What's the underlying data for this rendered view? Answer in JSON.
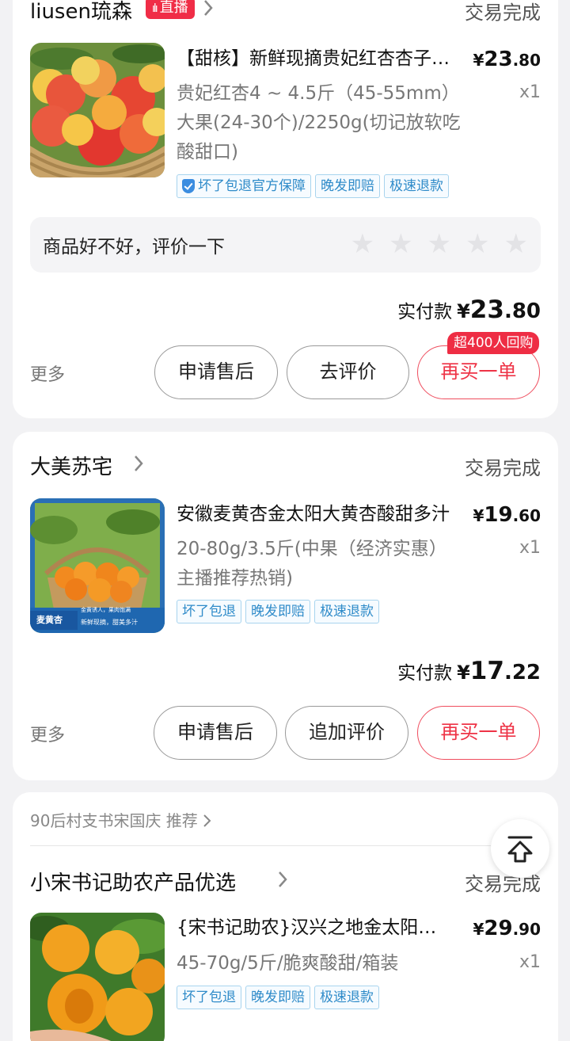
{
  "colors": {
    "accent": "#ee3346",
    "tag_blue": "#2f8bc9",
    "live_red": "#f02d47"
  },
  "orders": [
    {
      "shop_name": "liusen琉森",
      "live_badge": "直播",
      "status": "交易完成",
      "product": {
        "title": "【甜核】新鲜现摘贵妃红杏杏子包邮",
        "price_yen": "¥",
        "price_int": "23",
        "price_dec": ".80",
        "spec": "贵妃红杏4 ~ 4.5斤（45-55mm）大果(24-30个)/2250g(切记放软吃酸甜口)",
        "qty": "x1",
        "tags": [
          "坏了包退官方保障",
          "晚发即赔",
          "极速退款"
        ]
      },
      "review_prompt": "商品好不好，评价一下",
      "paid_label": "实付款",
      "paid_yen": "¥",
      "paid_int": "23",
      "paid_dec": ".80",
      "more": "更多",
      "buttons": [
        "申请售后",
        "去评价",
        "再买一单"
      ],
      "repurchase_badge": "超400人回购"
    },
    {
      "shop_name": "大美苏宅",
      "status": "交易完成",
      "product": {
        "title": "安徽麦黄杏金太阳大黄杏酸甜多汁",
        "price_yen": "¥",
        "price_int": "19",
        "price_dec": ".60",
        "spec": "20-80g/3.5斤(中果（经济实惠）主播推荐热销)",
        "qty": "x1",
        "tags": [
          "坏了包退",
          "晚发即赔",
          "极速退款"
        ],
        "image_captions": [
          "麦黄杏",
          "金黄诱人，果肉饱满",
          "新鲜现摘，甜美多汁"
        ]
      },
      "paid_label": "实付款",
      "paid_yen": "¥",
      "paid_int": "17",
      "paid_dec": ".22",
      "more": "更多",
      "buttons": [
        "申请售后",
        "追加评价",
        "再买一单"
      ]
    },
    {
      "recommender": "90后村支书宋国庆 推荐",
      "shop_name": "小宋书记助农产品优选",
      "status": "交易完成",
      "product": {
        "title": "{宋书记助农}汉兴之地金太阳杏子",
        "price_yen": "¥",
        "price_int": "29",
        "price_dec": ".90",
        "spec": "45-70g/5斤/脆爽酸甜/箱装",
        "qty": "x1",
        "tags": [
          "坏了包退",
          "晚发即赔",
          "极速退款"
        ]
      }
    }
  ],
  "fab_icon": "back-to-top-icon"
}
